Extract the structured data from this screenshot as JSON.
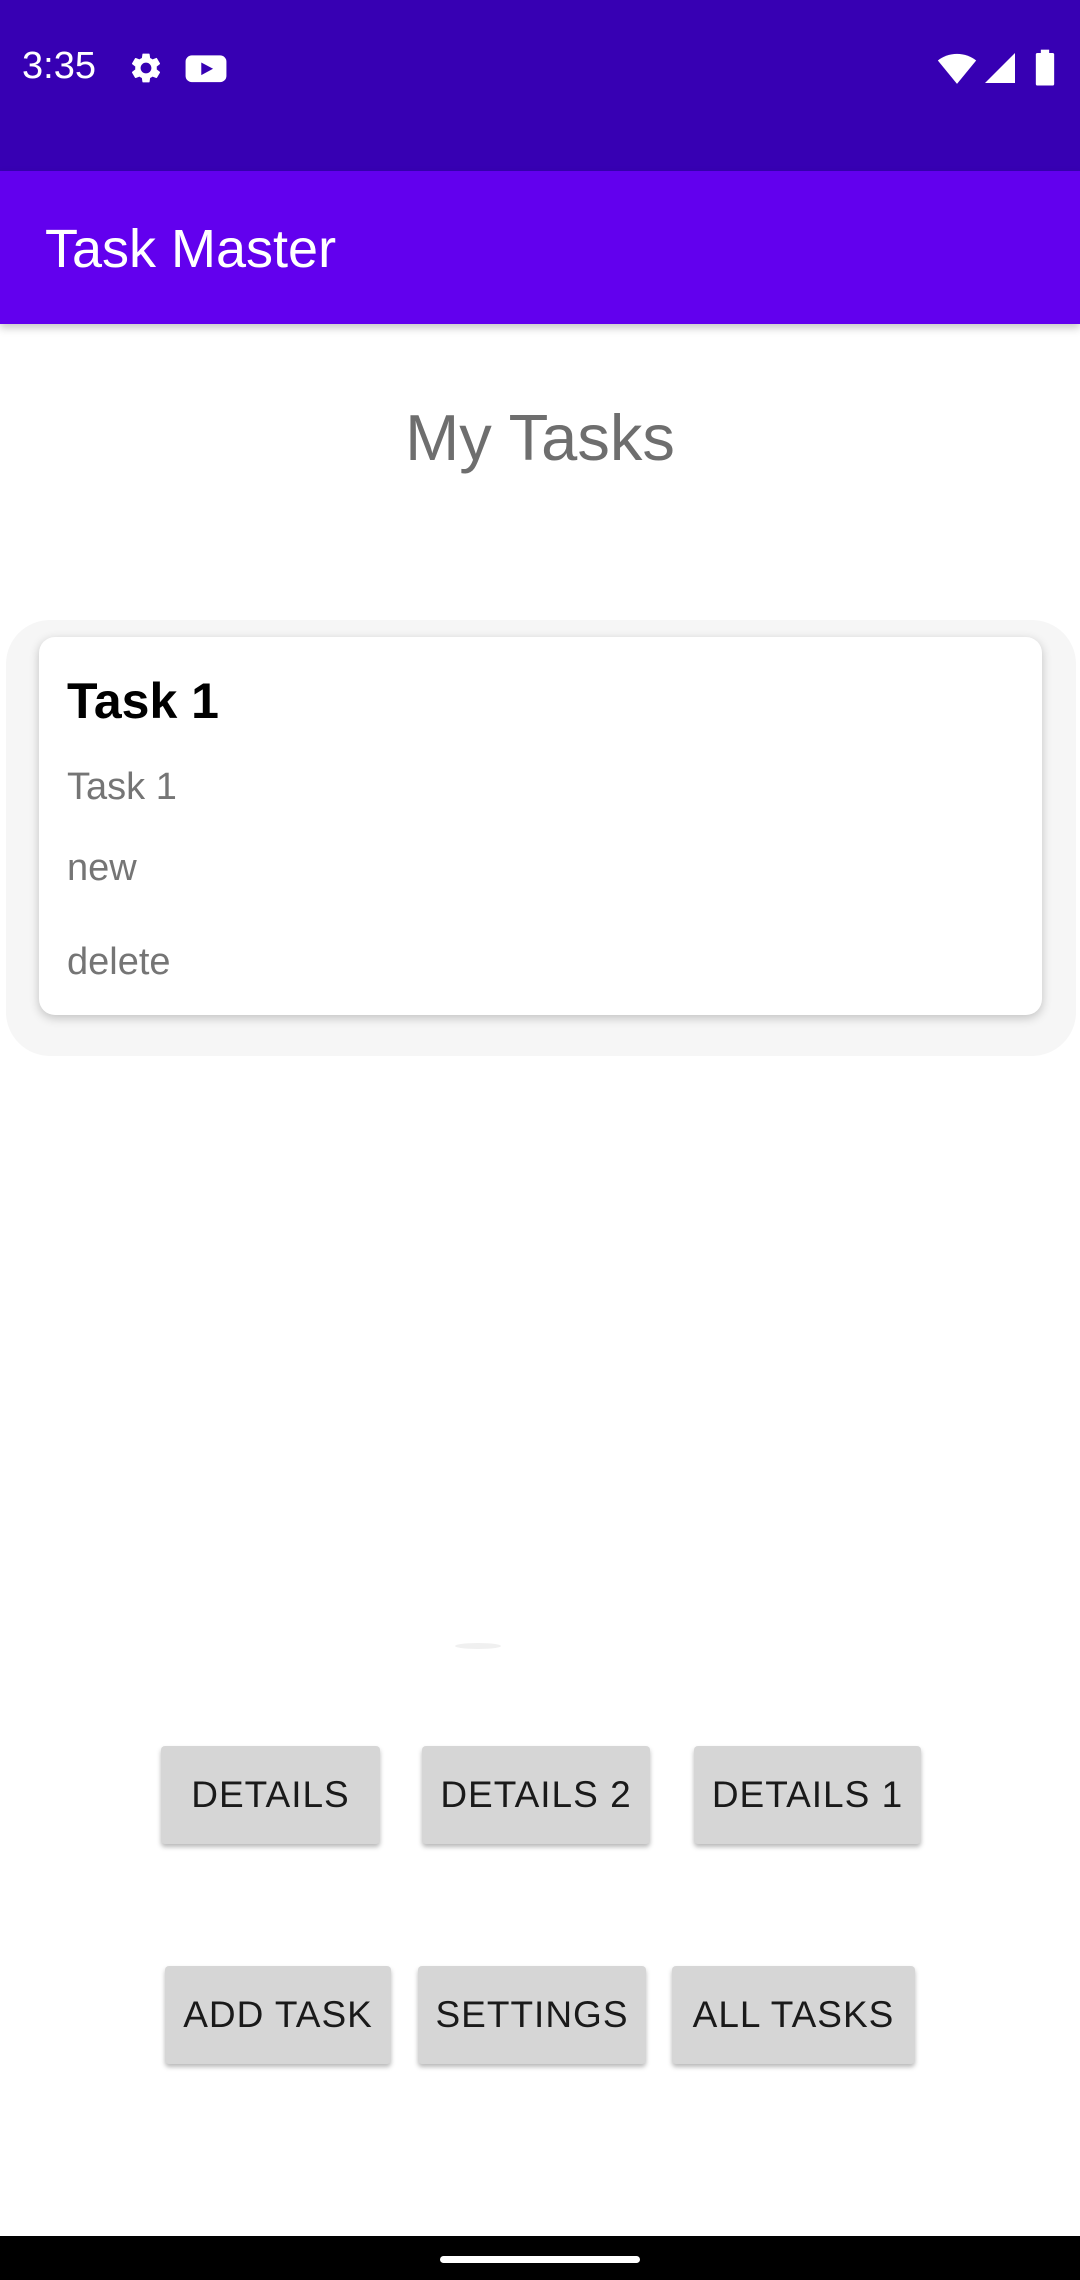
{
  "status_bar": {
    "time": "3:35",
    "left_icons": [
      "gear-icon",
      "youtube-icon"
    ],
    "right_icons": [
      "wifi-icon",
      "cell-signal-icon",
      "battery-icon"
    ]
  },
  "app_bar": {
    "title": "Task Master"
  },
  "main": {
    "title": "My Tasks",
    "tasks": [
      {
        "title": "Task 1",
        "body": "Task 1",
        "state": "new",
        "delete_label": "delete"
      }
    ]
  },
  "buttons": {
    "row1": [
      "DETAILS",
      "DETAILS 2",
      "DETAILS 1"
    ],
    "row2": [
      "ADD TASK",
      "SETTINGS",
      "ALL TASKS"
    ]
  },
  "colors": {
    "status_bar": "#3700b3",
    "app_bar": "#6200ee",
    "button": "#d6d6d6"
  }
}
